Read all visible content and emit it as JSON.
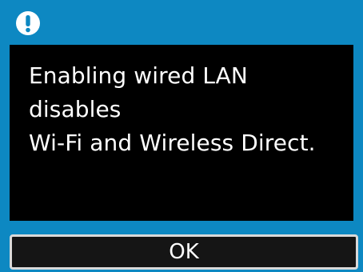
{
  "dialog": {
    "icon": "alert-icon",
    "message": "Enabling wired LAN disables\nWi-Fi and Wireless Direct.",
    "ok_label": "OK",
    "colors": {
      "frame": "#0d88c2",
      "background": "#000000",
      "text": "#ffffff",
      "button_border": "#d9d9d9"
    }
  }
}
